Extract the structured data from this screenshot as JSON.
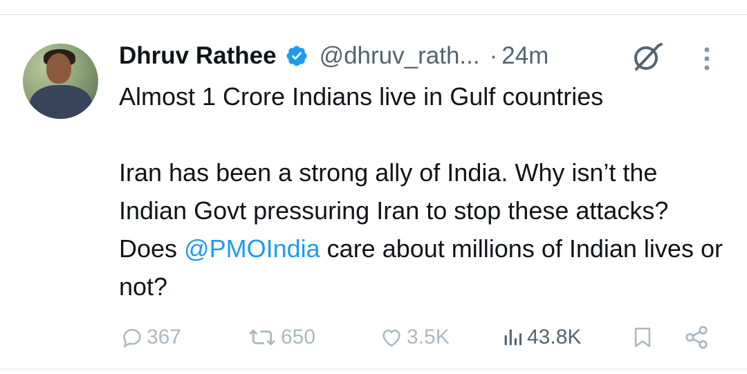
{
  "tweet": {
    "author": {
      "name": "Dhruv Rathee",
      "handle": "@dhruv_rath...",
      "verified": true,
      "avatar_icon": "avatar-photo"
    },
    "separator": "·",
    "time": "24m",
    "text_line1": "Almost 1 Crore Indians live in Gulf countries",
    "text_p2_before": "Iran has been a strong ally of India. Why isn’t the Indian Govt pressuring Iran to stop these attacks? Does ",
    "mention": "@PMOIndia",
    "text_p2_after": " care about millions of Indian lives or not?",
    "stats": {
      "replies": "367",
      "reposts": "650",
      "likes": "3.5K",
      "views": "43.8K"
    }
  },
  "icons": {
    "verified": "verified-badge-icon",
    "grok": "grok-icon",
    "more": "more-options-icon",
    "reply": "reply-icon",
    "repost": "repost-icon",
    "like": "like-icon",
    "views": "views-icon",
    "bookmark": "bookmark-icon",
    "share": "share-icon"
  },
  "colors": {
    "text": "#0f1419",
    "secondary": "#536471",
    "link": "#1d9bf0",
    "action_muted": "#aab8c2",
    "divider": "#eef1f2"
  }
}
